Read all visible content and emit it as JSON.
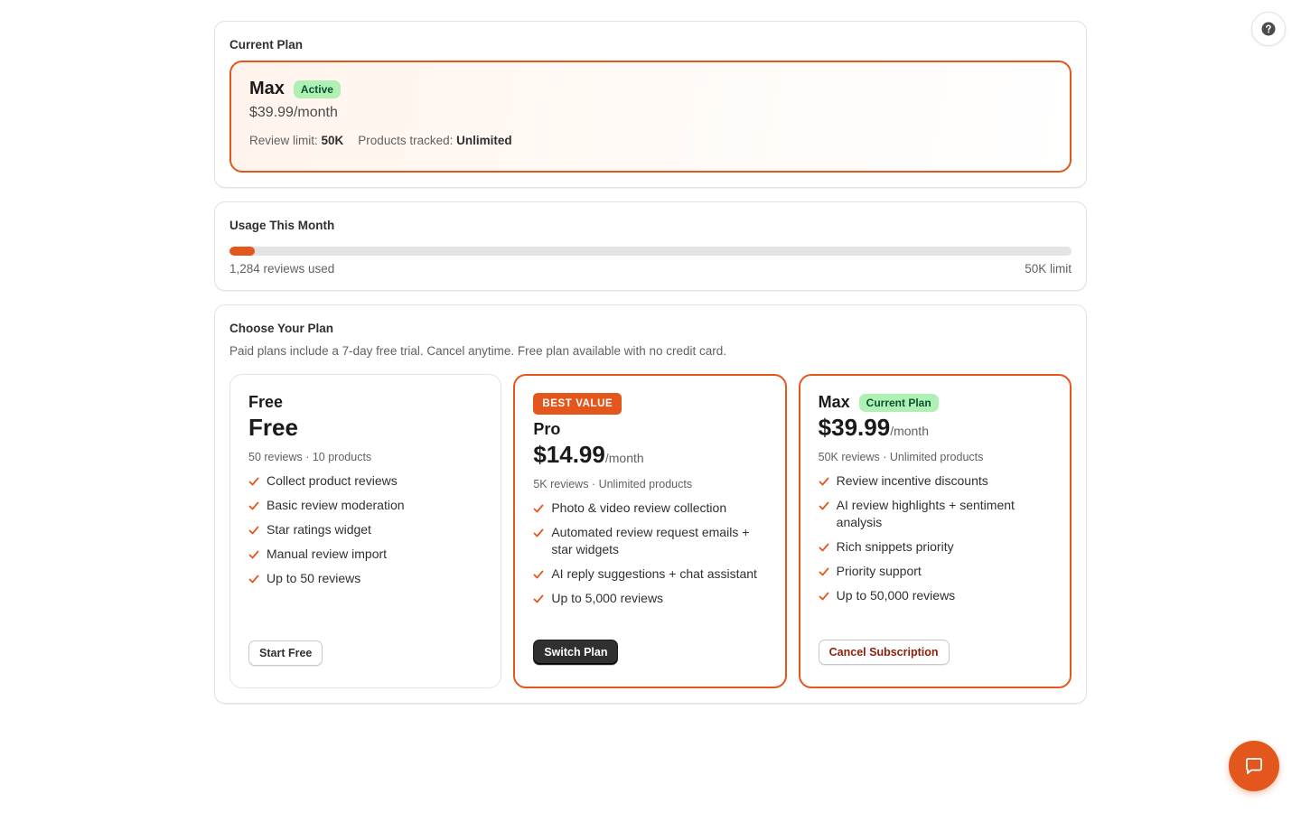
{
  "colors": {
    "accent": "#e4571c",
    "success_badge_bg": "#aff0b5",
    "success_badge_text": "#0c5132",
    "critical_text": "#8e1f0b",
    "dark_button": "#303030"
  },
  "floating": {
    "help_icon": "question-circle-icon",
    "chat_icon": "chat-bubble-icon"
  },
  "current_plan": {
    "title": "Current Plan",
    "name": "Max",
    "status": "Active",
    "price": "$39.99/month",
    "review_limit_label": "Review limit:",
    "review_limit_value": "50K",
    "products_label": "Products tracked:",
    "products_value": "Unlimited"
  },
  "usage": {
    "title": "Usage This Month",
    "used_text": "1,284 reviews used",
    "limit_text": "50K limit",
    "used": 1284,
    "limit": 50000
  },
  "choose": {
    "title": "Choose Your Plan",
    "subtitle": "Paid plans include a 7-day free trial. Cancel anytime. Free plan available with no credit card.",
    "plans": [
      {
        "name": "Free",
        "price": "Free",
        "per": "",
        "meta": "50 reviews · 10 products",
        "features": [
          "Collect product reviews",
          "Basic review moderation",
          "Star ratings widget",
          "Manual review import",
          "Up to 50 reviews"
        ],
        "button": "Start Free"
      },
      {
        "badge": "BEST VALUE",
        "name": "Pro",
        "price": "$14.99",
        "per": "/month",
        "meta": "5K reviews · Unlimited products",
        "features": [
          "Photo & video review collection",
          "Automated review request emails + star widgets",
          "AI reply suggestions + chat assistant",
          "Up to 5,000 reviews"
        ],
        "button": "Switch Plan"
      },
      {
        "name": "Max",
        "current_badge": "Current Plan",
        "price": "$39.99",
        "per": "/month",
        "meta": "50K reviews · Unlimited products",
        "features": [
          "Review incentive discounts",
          "AI review highlights + sentiment analysis",
          "Rich snippets priority",
          "Priority support",
          "Up to 50,000 reviews"
        ],
        "button": "Cancel Subscription"
      }
    ]
  }
}
